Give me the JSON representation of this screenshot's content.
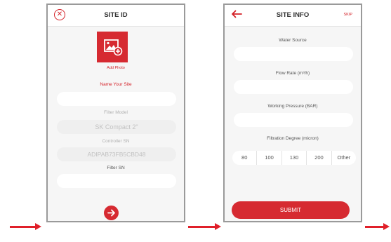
{
  "screen1": {
    "title": "SITE ID",
    "add_photo_label": "Add Photo",
    "name_label": "Name Your Site",
    "name_value": "",
    "filter_model_label": "Filter Model",
    "filter_model_value": "SK Compact 2\"",
    "controller_sn_label": "Controller SN",
    "controller_sn_value": "ADIPAB73FB5CBD48",
    "filter_sn_label": "Filter SN",
    "filter_sn_value": ""
  },
  "screen2": {
    "title": "SITE INFO",
    "skip_label": "SKIP",
    "water_source_label": "Water Source",
    "flow_rate_label": "Flow Rate (m³/h)",
    "working_pressure_label": "Working Pressure (BAR)",
    "filtration_degree_label": "Filtration Degree (micron)",
    "filtration_options": [
      "80",
      "100",
      "130",
      "200",
      "Other"
    ],
    "submit_label": "SUBMIT"
  },
  "colors": {
    "accent": "#d62a31",
    "arrow": "#e0202a"
  },
  "icons": {
    "close": "close-circle-icon",
    "back": "back-arrow-icon",
    "photo": "add-image-icon",
    "next": "next-arrow-icon"
  }
}
